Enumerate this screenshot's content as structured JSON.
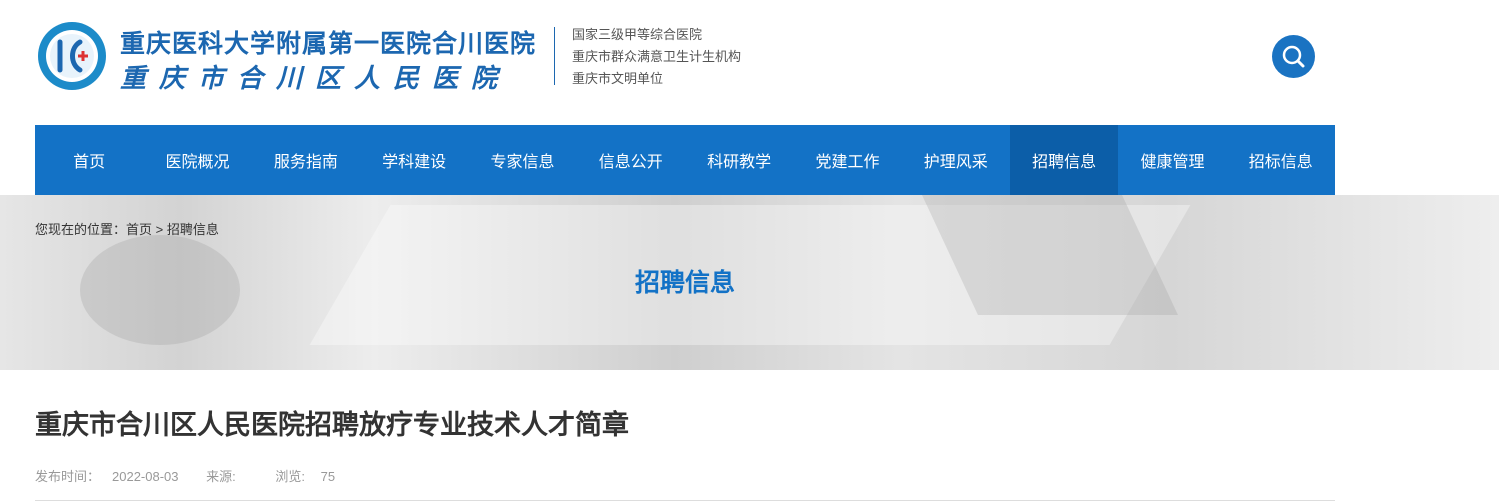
{
  "header": {
    "name_line1": "重庆医科大学附属第一医院合川医院",
    "name_line2": "重庆市合川区人民医院",
    "tags": [
      "国家三级甲等综合医院",
      "重庆市群众满意卫生计生机构",
      "重庆市文明单位"
    ],
    "search_icon": "search-icon"
  },
  "nav": {
    "items": [
      "首页",
      "医院概况",
      "服务指南",
      "学科建设",
      "专家信息",
      "信息公开",
      "科研教学",
      "党建工作",
      "护理风采",
      "招聘信息",
      "健康管理",
      "招标信息"
    ],
    "active": "招聘信息"
  },
  "breadcrumb": {
    "prefix": "您现在的位置：",
    "home": "首页",
    "sep": ">",
    "current": "招聘信息"
  },
  "banner": {
    "title": "招聘信息"
  },
  "article": {
    "title": "重庆市合川区人民医院招聘放疗专业技术人才简章",
    "publish_label": "发布时间：",
    "publish_date": "2022-08-03",
    "source_label": "来源:",
    "source_value": "",
    "views_label": "浏览:",
    "views_value": "75"
  },
  "colors": {
    "brand": "#1372c6",
    "nav_active": "#0c5ea8"
  }
}
